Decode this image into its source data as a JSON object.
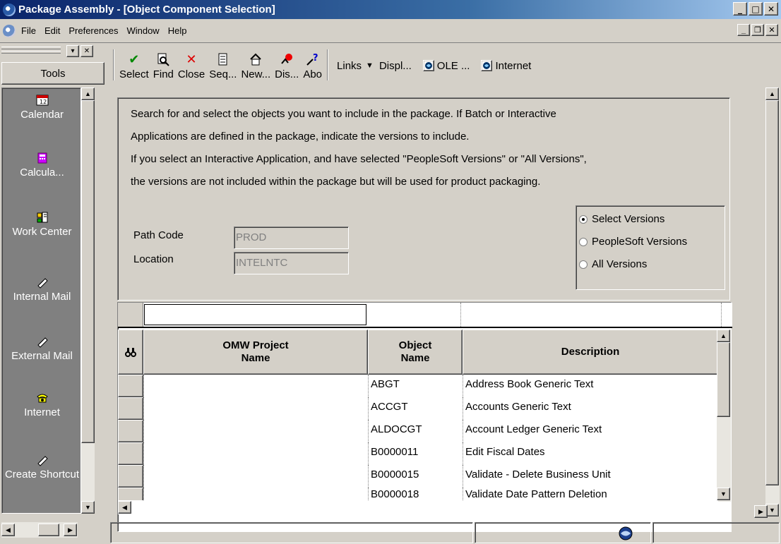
{
  "window": {
    "title": "Package Assembly - [Object Component Selection]"
  },
  "menu": [
    "File",
    "Edit",
    "Preferences",
    "Window",
    "Help"
  ],
  "tools": {
    "header": "Tools",
    "items": [
      {
        "label": "Calendar",
        "icon": "calendar-icon"
      },
      {
        "label": "Calcula...",
        "icon": "calculator-icon"
      },
      {
        "label": "Work Center",
        "icon": "work-center-icon"
      },
      {
        "label": "Internal Mail",
        "icon": "mail-icon"
      },
      {
        "label": "External Mail",
        "icon": "mail-icon"
      },
      {
        "label": "Internet",
        "icon": "phone-icon"
      },
      {
        "label": "Create Shortcut",
        "icon": "shortcut-icon"
      }
    ]
  },
  "toolbar": {
    "select": "Select",
    "find": "Find",
    "close": "Close",
    "seq": "Seq...",
    "new": "New...",
    "dis": "Dis...",
    "abo": "Abo",
    "links": "Links",
    "displ": "Displ...",
    "ole": "OLE ...",
    "internet": "Internet"
  },
  "instructions": [
    "Search for and select the objects you want to include in the package.  If Batch or Interactive",
    "Applications are defined in the package, indicate the versions to include.",
    "If you select an Interactive Application, and have selected \"PeopleSoft Versions\" or \"All Versions\",",
    "the versions are not included within the package but will be used for product packaging."
  ],
  "fields": {
    "path_code_label": "Path Code",
    "path_code_value": "PROD",
    "location_label": "Location",
    "location_value": "INTELNTC"
  },
  "versions": {
    "options": [
      "Select Versions",
      "PeopleSoft Versions",
      "All Versions"
    ],
    "selected": "Select Versions"
  },
  "grid": {
    "columns": [
      "OMW Project Name",
      "Object Name",
      "Description"
    ],
    "rows": [
      {
        "project": "",
        "object": "ABGT",
        "description": "Address Book Generic Text"
      },
      {
        "project": "",
        "object": "ACCGT",
        "description": "Accounts Generic Text"
      },
      {
        "project": "",
        "object": "ALDOCGT",
        "description": "Account Ledger Generic Text"
      },
      {
        "project": "",
        "object": "B0000011",
        "description": "Edit Fiscal Dates"
      },
      {
        "project": "",
        "object": "B0000015",
        "description": "Validate - Delete Business Unit"
      },
      {
        "project": "",
        "object": "B0000018",
        "description": "Validate Date Pattern Deletion"
      }
    ]
  },
  "colors": {
    "title_start": "#0a246a",
    "title_end": "#a6caf0",
    "face": "#d4d0c8",
    "tool_panel": "#808080"
  }
}
